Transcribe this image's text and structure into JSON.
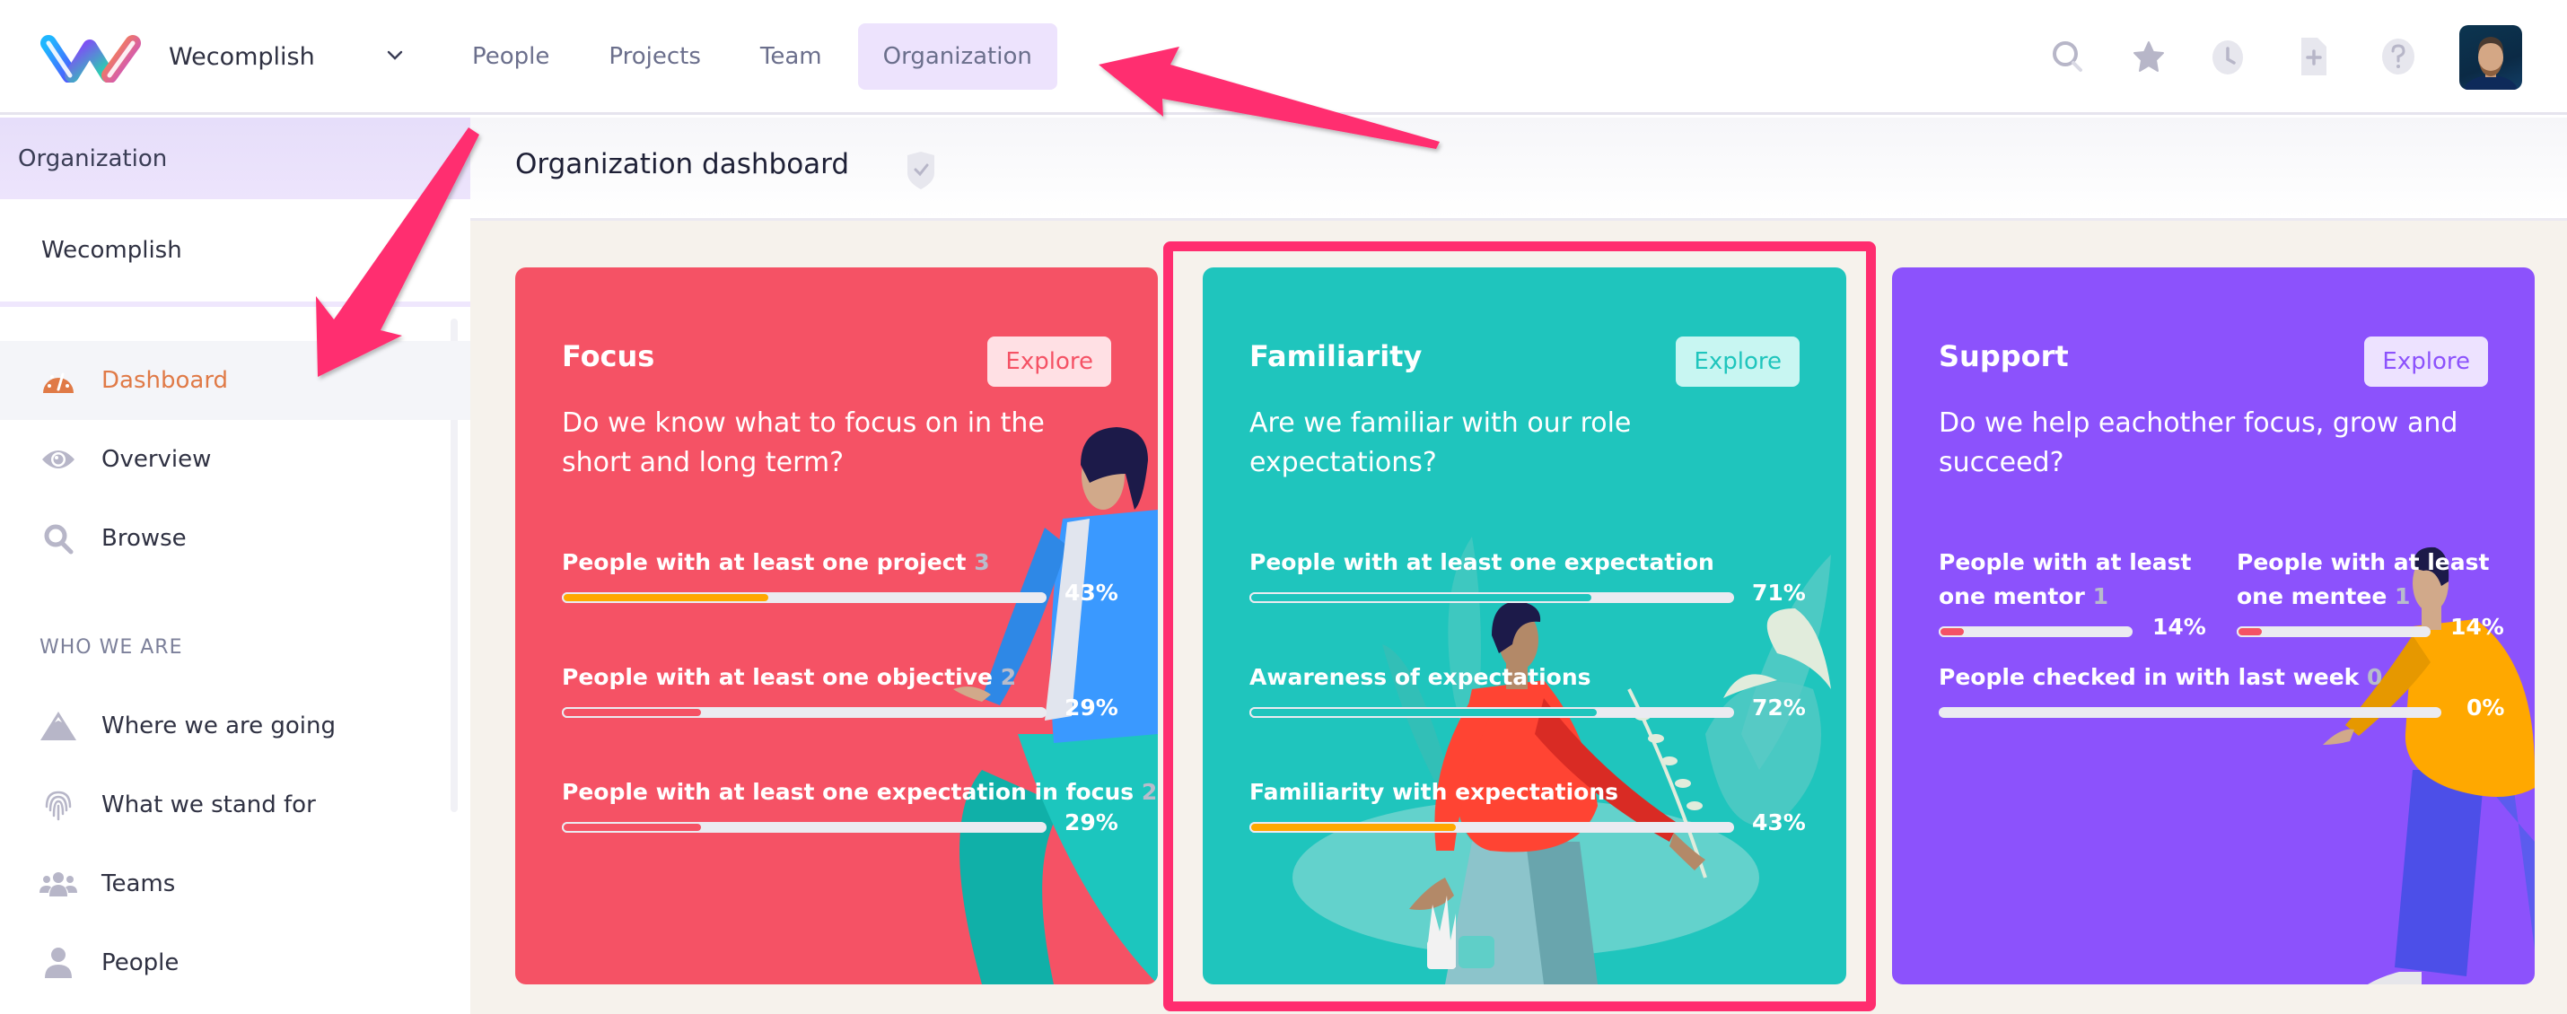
{
  "topbar": {
    "logo_icon": "wecomplish-logo-icon",
    "org_name": "Wecomplish",
    "org_dropdown_icon": "chevron-down-icon",
    "nav": [
      {
        "label": "People",
        "active": false
      },
      {
        "label": "Projects",
        "active": false
      },
      {
        "label": "Team",
        "active": false
      },
      {
        "label": "Organization",
        "active": true
      }
    ],
    "icons": [
      "search-icon",
      "star-icon",
      "clock-icon",
      "add-document-icon",
      "help-icon"
    ],
    "avatar": "user-avatar"
  },
  "sidebar": {
    "section_title": "Organization",
    "company": "Wecomplish",
    "items": [
      {
        "label": "Dashboard",
        "icon": "dashboard-gauge-icon",
        "active": true
      },
      {
        "label": "Overview",
        "icon": "eye-icon",
        "active": false
      },
      {
        "label": "Browse",
        "icon": "search-icon",
        "active": false
      }
    ],
    "who_we_are": {
      "heading": "WHO WE ARE",
      "items": [
        {
          "label": "Where we are going",
          "icon": "mountain-icon"
        },
        {
          "label": "What we stand for",
          "icon": "fingerprint-icon"
        },
        {
          "label": "Teams",
          "icon": "users-icon"
        },
        {
          "label": "People",
          "icon": "user-icon"
        }
      ]
    }
  },
  "main": {
    "title": "Organization dashboard",
    "title_icon": "shield-check-icon",
    "cards": [
      {
        "title": "Focus",
        "explore": "Explore",
        "question": "Do we know what to focus on in the short and long term?",
        "color": "#f55265",
        "metrics": [
          {
            "label": "People with at least one project",
            "count": "3",
            "percent": 43,
            "percent_label": "43%",
            "fill": "#ffa800"
          },
          {
            "label": "People with at least one objective",
            "count": "2",
            "percent": 29,
            "percent_label": "29%",
            "fill": "#f55265"
          },
          {
            "label": "People with at least one expectation in focus",
            "count": "2",
            "percent": 29,
            "percent_label": "29%",
            "fill": "#f55265"
          }
        ]
      },
      {
        "title": "Familiarity",
        "explore": "Explore",
        "question": "Are we familiar with our role expectations?",
        "color": "#1fc5bd",
        "metrics": [
          {
            "label": "People with at least one expectation",
            "count": "",
            "percent": 71,
            "percent_label": "71%",
            "fill": "#1fc5bd"
          },
          {
            "label": "Awareness of expectations",
            "count": "",
            "percent": 72,
            "percent_label": "72%",
            "fill": "#1fc5bd"
          },
          {
            "label": "Familiarity with expectations",
            "count": "",
            "percent": 43,
            "percent_label": "43%",
            "fill": "#ffa800"
          }
        ]
      },
      {
        "title": "Support",
        "explore": "Explore",
        "question": "Do we help eachother focus, grow and succeed?",
        "color": "#8c52fc",
        "metrics": [
          {
            "label_line1": "People with at least",
            "label_line2": "one mentor",
            "count": "1",
            "percent": 14,
            "percent_label": "14%",
            "fill": "#f55265"
          },
          {
            "label_line1": "People with at least",
            "label_line2": "one mentee",
            "count": "1",
            "percent": 14,
            "percent_label": "14%",
            "fill": "#f55265"
          },
          {
            "label": "People checked in with last week",
            "count": "0",
            "percent": 0,
            "percent_label": "0%",
            "fill": "#f55265"
          }
        ]
      }
    ]
  },
  "annotations": {
    "highlight_color": "#ff2d6f",
    "highlighted_card": "Familiarity",
    "arrows": [
      "arrow-to-organization-tab",
      "arrow-to-dashboard-item"
    ]
  }
}
